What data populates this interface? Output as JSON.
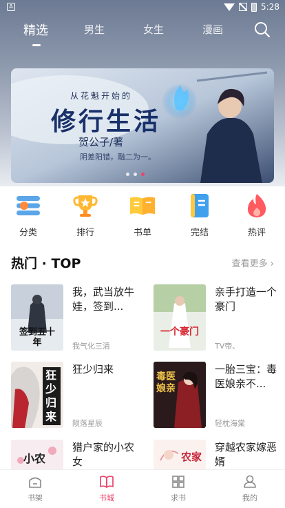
{
  "status_bar": {
    "time": "5:28",
    "left_icon": "A"
  },
  "tabs": [
    {
      "label": "精选",
      "active": true
    },
    {
      "label": "男生",
      "active": false
    },
    {
      "label": "女生",
      "active": false
    },
    {
      "label": "漫画",
      "active": false
    }
  ],
  "banner": {
    "subtitle": "从花魁开始的",
    "title": "修行生活",
    "author": "贺公子/著",
    "tagline": "阴差阳错，融二为一。",
    "dots": 3,
    "active_dot": 2
  },
  "categories": [
    {
      "label": "分类",
      "icon": "category-icon"
    },
    {
      "label": "排行",
      "icon": "trophy-icon"
    },
    {
      "label": "书单",
      "icon": "booklist-icon"
    },
    {
      "label": "完结",
      "icon": "completed-book-icon"
    },
    {
      "label": "热评",
      "icon": "flame-icon"
    }
  ],
  "section": {
    "title": "热门 · TOP",
    "more": "查看更多"
  },
  "books": [
    {
      "title": "我，武当放牛娃，签到...",
      "author": "我气化三清",
      "cover_text": "签到五十年"
    },
    {
      "title": "亲手打造一个豪门",
      "author": "TV帝、",
      "cover_text": "一个豪门"
    },
    {
      "title": "狂少归来",
      "author": "陨落星辰",
      "cover_text": "狂少归来"
    },
    {
      "title": "一胎三宝：毒医娘亲不...",
      "author": "轻枕海棠",
      "cover_text": "毒医娘亲"
    },
    {
      "title": "猎户家的小农女",
      "author": "",
      "cover_text": "小农女"
    },
    {
      "title": "穿越农家嫁恶婿",
      "author": "",
      "cover_text": "农家"
    }
  ],
  "bottom_nav": [
    {
      "label": "书架",
      "icon": "bookshelf-icon",
      "active": false
    },
    {
      "label": "书城",
      "icon": "bookstore-icon",
      "active": true
    },
    {
      "label": "求书",
      "icon": "request-book-icon",
      "active": false
    },
    {
      "label": "我的",
      "icon": "profile-icon",
      "active": false
    }
  ],
  "colors": {
    "accent": "#e8456b",
    "header_top": "#6c7a93"
  }
}
